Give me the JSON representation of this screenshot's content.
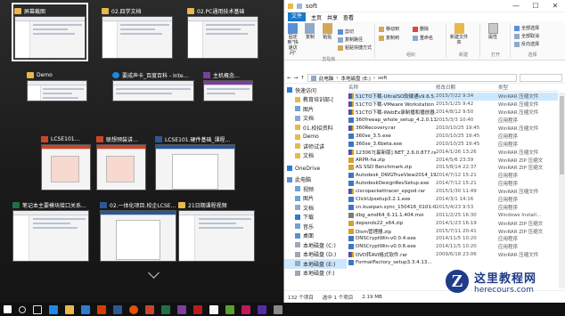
{
  "task_view": {
    "thumbs": [
      {
        "label": "屏幕截图",
        "icon": "folder"
      },
      {
        "label": "02.四学文档",
        "icon": "folder"
      },
      {
        "label": "02.PC通用技术基础",
        "icon": "folder"
      },
      {
        "label": "Demo",
        "icon": "folder"
      },
      {
        "label": "要成声卡_百度百科 - Inte...",
        "icon": "ie"
      },
      {
        "label": "主机概念...",
        "icon": "onenote"
      },
      {
        "label": "LCSE101...",
        "icon": "ppt"
      },
      {
        "label": "联想预装讲...",
        "icon": "ppt"
      },
      {
        "label": "LCSE101.硬件基础_课程...",
        "icon": "word"
      },
      {
        "label": "笔记本主要模块接口关系...",
        "icon": "excel"
      },
      {
        "label": "02.一体化项目.校企LCSE...",
        "icon": "word"
      },
      {
        "label": "21日期课程视频",
        "icon": "folder"
      }
    ]
  },
  "explorer": {
    "title": "soft",
    "window_controls": [
      "—",
      "☐",
      "✕"
    ],
    "tabs": [
      "文件",
      "主页",
      "共享",
      "查看"
    ],
    "ribbon": {
      "clipboard": {
        "pin": "固定到\"快速访问\"",
        "copy": "复制",
        "paste": "粘贴",
        "cut": "剪切",
        "copy_path": "复制路径",
        "paste_shortcut": "粘贴快捷方式",
        "label": "剪贴板"
      },
      "organize": {
        "move_to": "移动到",
        "copy_to": "复制到",
        "delete": "删除",
        "rename": "重命名",
        "label": "组织"
      },
      "new": {
        "new_folder": "新建文件夹",
        "label": "新建"
      },
      "open": {
        "properties": "属性",
        "label": "打开"
      },
      "select": {
        "all": "全部选择",
        "none": "全部取消",
        "invert": "反向选择",
        "label": "选择"
      }
    },
    "breadcrumb": [
      "此电脑",
      "本地磁盘 (E:)",
      "soft"
    ],
    "columns": {
      "name": "名称",
      "date": "修改日期",
      "type": "类型"
    },
    "nav": [
      {
        "label": "快速访问",
        "type": "star"
      },
      {
        "label": "教育培训部-[",
        "type": "folder"
      },
      {
        "label": "图片",
        "type": "pic"
      },
      {
        "label": "文档",
        "type": "doc"
      },
      {
        "label": "01.校招资料",
        "type": "folder"
      },
      {
        "label": "Demo",
        "type": "folder"
      },
      {
        "label": "讲师试讲",
        "type": "folder"
      },
      {
        "label": "文档",
        "type": "folder"
      },
      {
        "label": "OneDrive",
        "type": "cloud"
      },
      {
        "label": "此电脑",
        "type": "pc"
      },
      {
        "label": "视频",
        "type": "video"
      },
      {
        "label": "图片",
        "type": "pic"
      },
      {
        "label": "文档",
        "type": "doc"
      },
      {
        "label": "下载",
        "type": "down"
      },
      {
        "label": "音乐",
        "type": "music"
      },
      {
        "label": "桌面",
        "type": "desk"
      },
      {
        "label": "本地磁盘 (C:)",
        "type": "drive"
      },
      {
        "label": "本地磁盘 (D:)",
        "type": "drive"
      },
      {
        "label": "本地磁盘 (E:)",
        "type": "drive"
      },
      {
        "label": "本地磁盘 (F:)",
        "type": "drive"
      }
    ],
    "files": [
      {
        "name": "51CTO下载-UltraISO软碟通v9.6.5.32...",
        "date": "2015/7/22 9:34",
        "type": "WinRAR 压缩文件",
        "icon": "rar"
      },
      {
        "name": "51CTO下载-VMware Workstation 11 ...",
        "date": "2015/1/25 9:42",
        "type": "WinRAR 压缩文件",
        "icon": "rar"
      },
      {
        "name": "51CTO下载-WebEx录制播和播放器.rar",
        "date": "2014/8/12 9:50",
        "type": "WinRAR 压缩文件",
        "icon": "rar"
      },
      {
        "name": "360freeap_whole_setup_4.2.0.1101.exe",
        "date": "2015/3/3 10:40",
        "type": "应用程序",
        "icon": "exe"
      },
      {
        "name": "360Recovery.rar",
        "date": "2010/10/25 19:45",
        "type": "WinRAR 压缩文件",
        "icon": "rar"
      },
      {
        "name": "360se_3.5.exe",
        "date": "2010/10/25 19:45",
        "type": "应用程序",
        "icon": "exe"
      },
      {
        "name": "360se_3.6beta.exe",
        "date": "2010/10/25 19:45",
        "type": "应用程序",
        "icon": "exe"
      },
      {
        "name": "123067[最新版].NET_2.6.0.877.rar",
        "date": "2014/1/26 13:26",
        "type": "WinRAR 压缩文件",
        "icon": "rar"
      },
      {
        "name": "ARPR-ha.zip",
        "date": "2014/5/6 23:39",
        "type": "WinRAR ZIP 压缩文件",
        "icon": "zip"
      },
      {
        "name": "AS SSD Benchmark.zip",
        "date": "2013/8/14 22:37",
        "type": "WinRAR ZIP 压缩文件",
        "icon": "zip"
      },
      {
        "name": "Autodesk_DWGTrueView2014_19.1.18...",
        "date": "2014/7/12 15:21",
        "type": "应用程序",
        "icon": "exe"
      },
      {
        "name": "AutodeskDesignRevSetup.exe",
        "date": "2014/7/12 15:21",
        "type": "应用程序",
        "icon": "exe"
      },
      {
        "name": "ciscopackettracer_xpgod.rar",
        "date": "2015/1/30 11:49",
        "type": "WinRAR 压缩文件",
        "icon": "rar"
      },
      {
        "name": "ClickUpsetup3.2.1.exe",
        "date": "2014/3/1 14:16",
        "type": "应用程序",
        "icon": "exe"
      },
      {
        "name": "cn.kuaipan.sync_150416_0101-0201-0...",
        "date": "2015/4/23 9:53",
        "type": "应用程序",
        "icon": "exe"
      },
      {
        "name": "dbg_amd64_6.11.1.404.msi",
        "date": "2011/2/25 16:30",
        "type": "Windows Install...",
        "icon": "msi"
      },
      {
        "name": "depends22_x64.zip",
        "date": "2014/1/23 16:19",
        "type": "WinRAR ZIP 压缩文件",
        "icon": "zip"
      },
      {
        "name": "Dism管理器.zip",
        "date": "2015/7/11 20:41",
        "type": "WinRAR ZIP 压缩文件",
        "icon": "zip"
      },
      {
        "name": "DNSCryptWin-v0.0.4.exe",
        "date": "2014/11/5 10:20",
        "type": "应用程序",
        "icon": "exe"
      },
      {
        "name": "DNSCryptWin-v0.0.6.exe",
        "date": "2014/11/5 10:20",
        "type": "应用程序",
        "icon": "exe"
      },
      {
        "name": "DVD转AVI格式软件.rar",
        "date": "2009/6/18 23:06",
        "type": "WinRAR 压缩文件",
        "icon": "rar"
      },
      {
        "name": "FormatFactory_setup3.3.4.13...",
        "date": "",
        "type": "",
        "icon": "exe"
      }
    ],
    "status": {
      "count": "132 个项目",
      "selected": "选中 1 个项目",
      "size": "2.19 MB"
    }
  },
  "watermark": {
    "logo": "Z",
    "title": "这里教程网",
    "url": "herecours.com"
  },
  "colors": {
    "accent": "#1979ca",
    "taskbar": "#101010"
  }
}
